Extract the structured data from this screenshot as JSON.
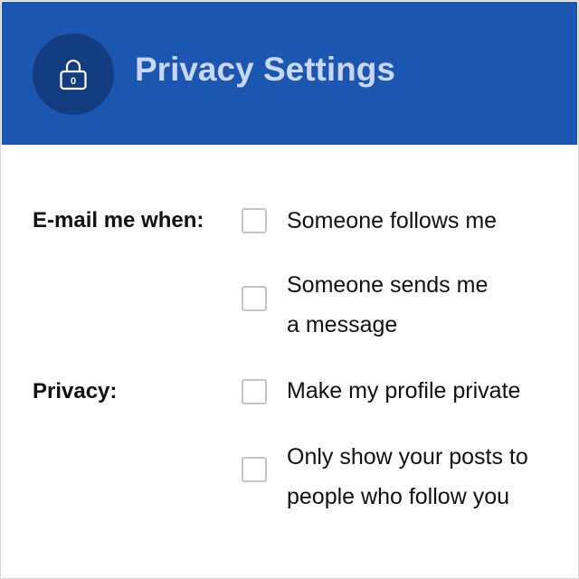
{
  "header": {
    "title": "Privacy Settings",
    "icon": "lock-icon",
    "icon_badge": "0",
    "background_color": "#1b56b0",
    "icon_circle_color": "#133d80",
    "title_color": "#c9d7f7"
  },
  "email_section": {
    "label": "E-mail me when:",
    "options": [
      {
        "lines": [
          "Someone follows me"
        ],
        "checked": false
      },
      {
        "lines": [
          "Someone sends me",
          "a message"
        ],
        "checked": false
      }
    ]
  },
  "privacy_section": {
    "label": "Privacy:",
    "options": [
      {
        "lines": [
          "Make my profile private"
        ],
        "checked": false
      },
      {
        "lines": [
          "Only show your posts to",
          "people who follow you"
        ],
        "checked": false
      }
    ]
  }
}
